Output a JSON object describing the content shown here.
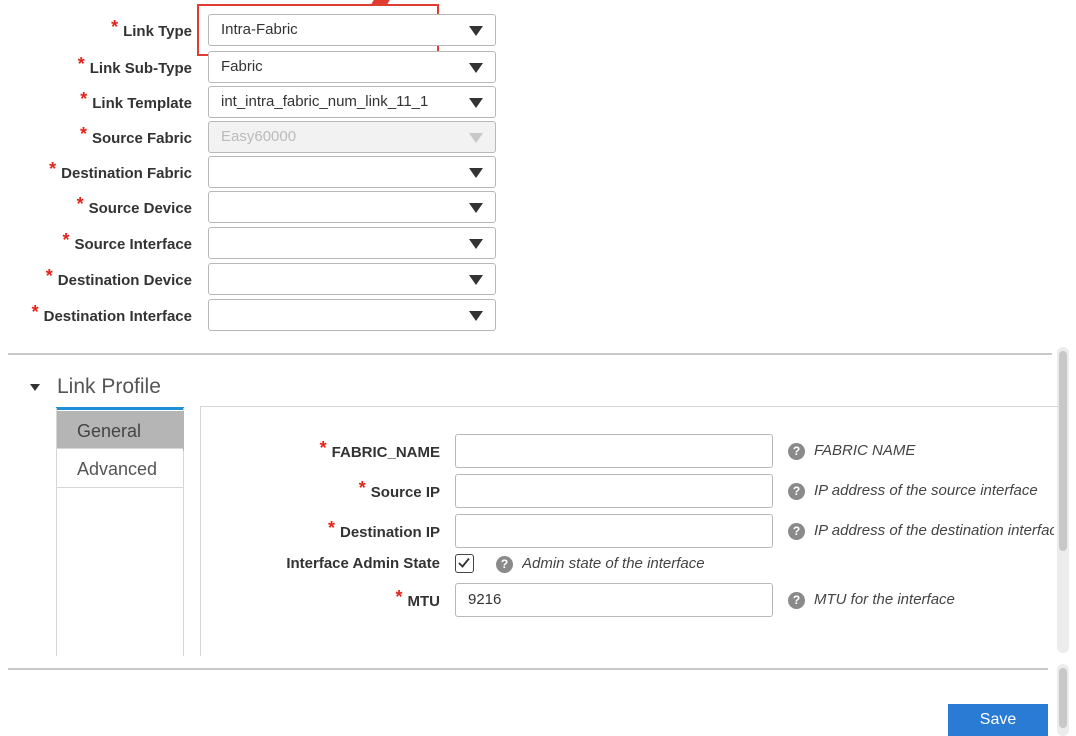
{
  "form": {
    "fields": [
      {
        "label": "Link Type",
        "value": "Intra-Fabric"
      },
      {
        "label": "Link Sub-Type",
        "value": "Fabric"
      },
      {
        "label": "Link Template",
        "value": "int_intra_fabric_num_link_11_1"
      },
      {
        "label": "Source Fabric",
        "value": "Easy60000"
      },
      {
        "label": "Destination Fabric",
        "value": ""
      },
      {
        "label": "Source Device",
        "value": ""
      },
      {
        "label": "Source Interface",
        "value": ""
      },
      {
        "label": "Destination Device",
        "value": ""
      },
      {
        "label": "Destination Interface",
        "value": ""
      }
    ],
    "required_marker": "*"
  },
  "profile": {
    "section_title": "Link Profile",
    "tabs": [
      "General",
      "Advanced"
    ],
    "fields": [
      {
        "label": "FABRIC_NAME",
        "value": "",
        "help": "FABRIC NAME"
      },
      {
        "label": "Source IP",
        "value": "",
        "help": "IP address of the source interface"
      },
      {
        "label": "Destination IP",
        "value": "",
        "help": "IP address of the destination interface"
      },
      {
        "label": "Interface Admin State",
        "checked": true,
        "help": "Admin state of the interface"
      },
      {
        "label": "MTU",
        "value": "9216",
        "help": "MTU for the interface"
      }
    ]
  },
  "footer": {
    "save_label": "Save"
  },
  "colors": {
    "required": "#e2231a",
    "primary_button": "#2a7bd3",
    "tab_accent": "#1e90d8",
    "highlight": "#e03c31"
  },
  "icons": {
    "dropdown": "caret-down-icon",
    "help": "question-circle-icon",
    "section_toggle": "triangle-down-icon",
    "check": "checkmark-icon"
  }
}
